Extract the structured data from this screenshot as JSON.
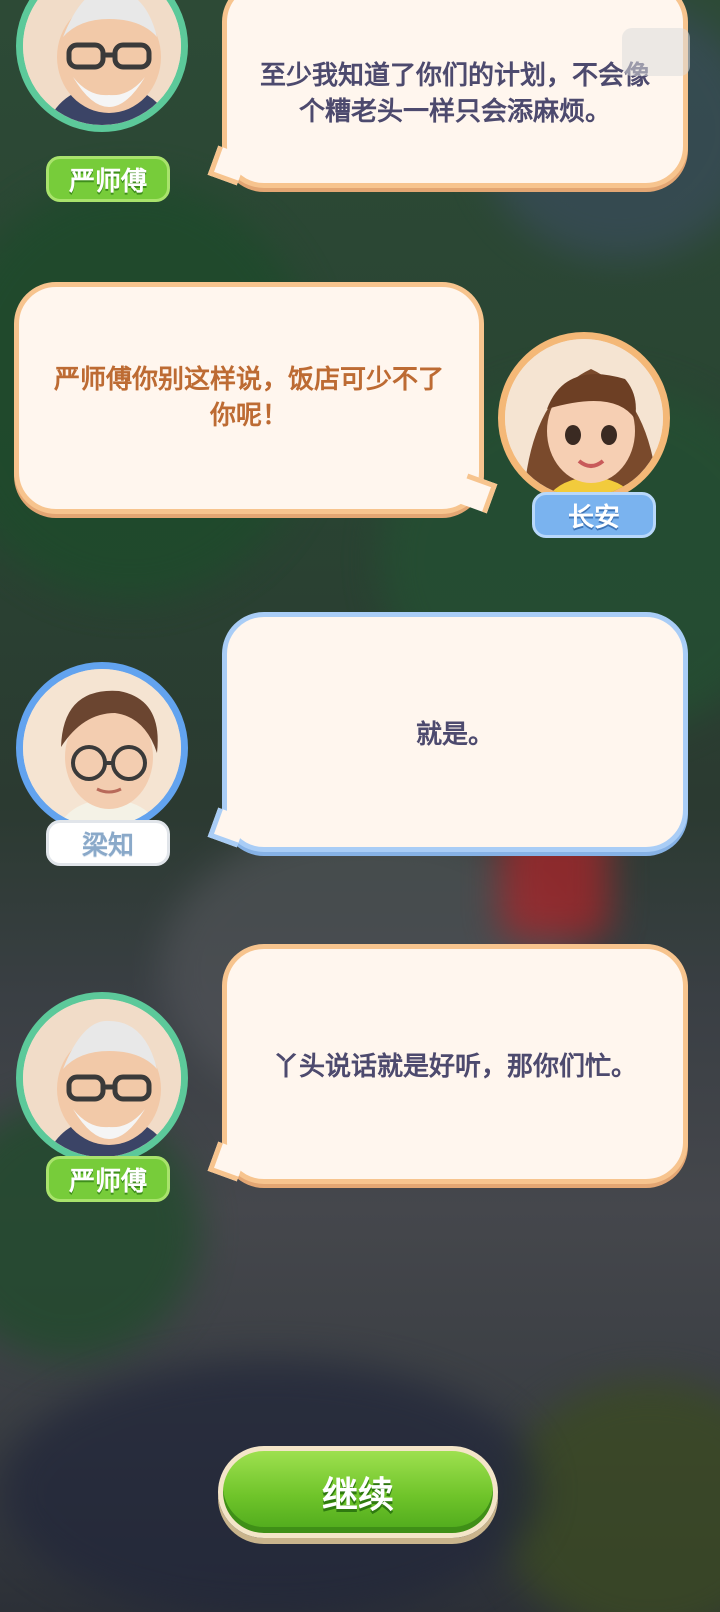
{
  "dialogues": [
    {
      "speaker": "严师傅",
      "text": "至少我知道了你们的计划，不会像个糟老头一样只会添麻烦。"
    },
    {
      "speaker": "长安",
      "text": "严师傅你别这样说，饭店可少不了你呢！"
    },
    {
      "speaker": "梁知",
      "text": "就是。"
    },
    {
      "speaker": "严师傅",
      "text": "丫头说话就是好听，那你们忙。"
    }
  ],
  "continue_label": "继续",
  "colors": {
    "orange_border": "#f7c48e",
    "blue_border": "#a9cdf6",
    "green_tag": "#77cc3a",
    "button_green": "#6fc42a"
  }
}
